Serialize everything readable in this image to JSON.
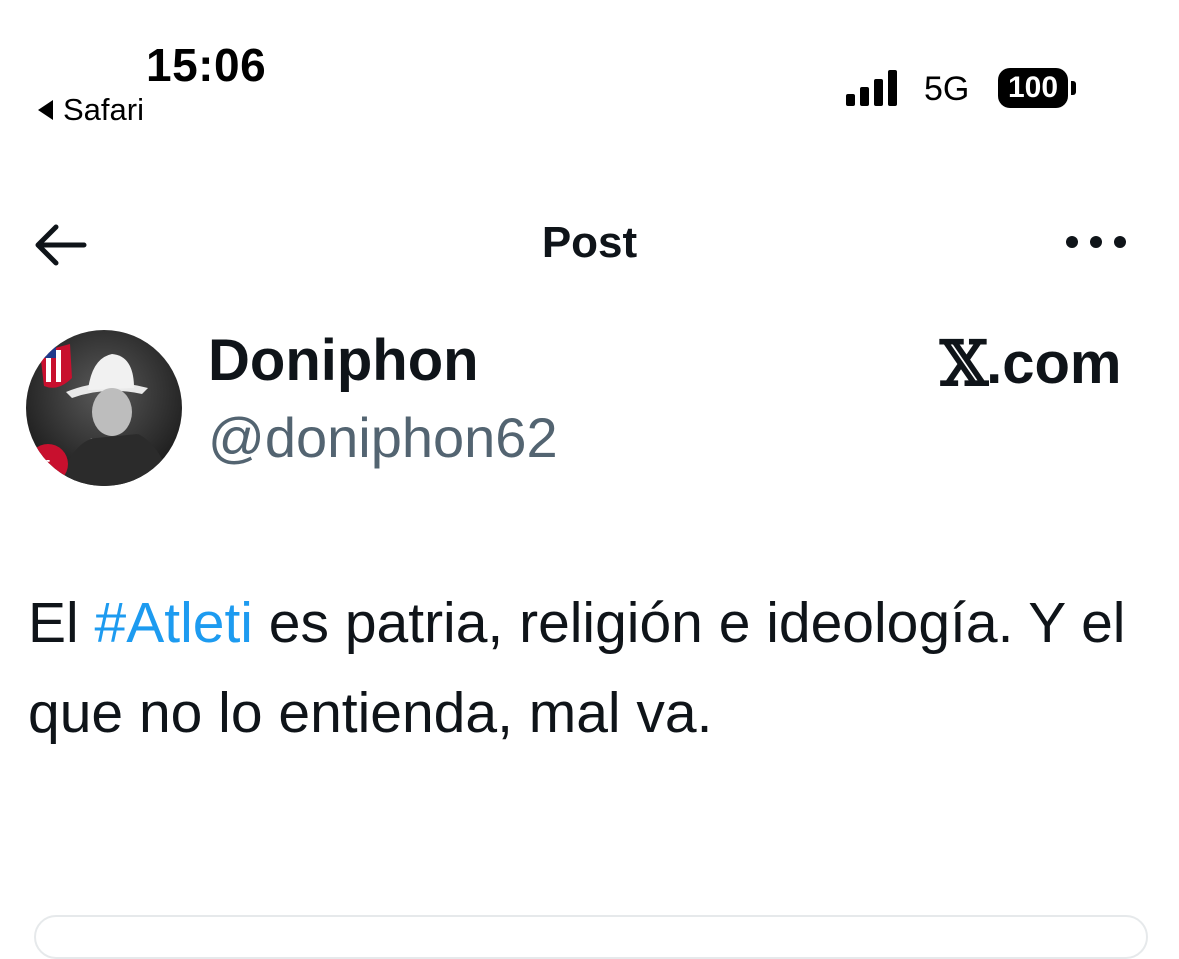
{
  "status_bar": {
    "time": "15:06",
    "back_app_label": "Safari",
    "network": "5G",
    "battery": "100"
  },
  "nav": {
    "title": "Post",
    "back_icon": "arrow-left-icon",
    "more_icon": "more-horizontal-icon"
  },
  "post": {
    "author_name": "Doniphon",
    "author_handle": "@doniphon62",
    "brand_mark": "𝕏",
    "brand_domain": ".com",
    "text_part1": "El ",
    "hashtag": "#Atleti",
    "text_part2": " es patria, religión e ideología. Y el que no lo entienda, mal va."
  },
  "colors": {
    "text": "#0f1419",
    "secondary": "#536471",
    "accent": "#1d9bf0"
  }
}
